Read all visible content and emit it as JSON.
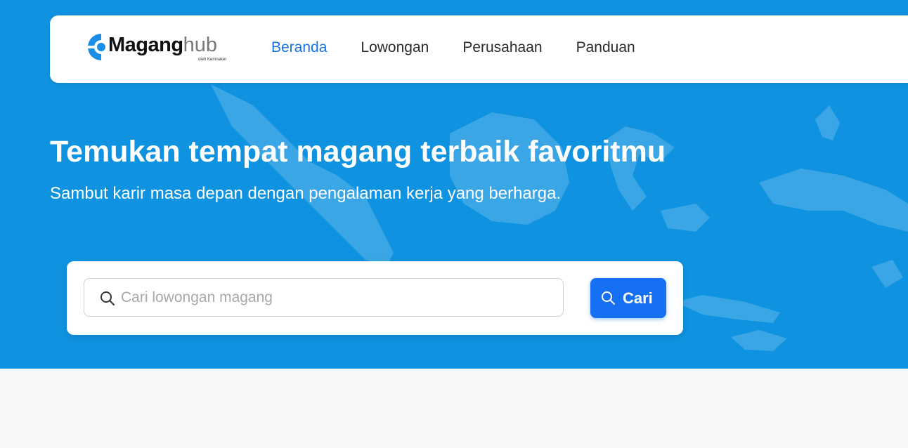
{
  "brand": {
    "name": "Magang",
    "suffix": "hub",
    "tagline": "oleh Kemnaker",
    "colors": {
      "primary": "#0f93e0",
      "accent": "#1673e6",
      "button": "#1570f2"
    }
  },
  "nav": {
    "items": [
      {
        "label": "Beranda",
        "active": true
      },
      {
        "label": "Lowongan",
        "active": false
      },
      {
        "label": "Perusahaan",
        "active": false
      },
      {
        "label": "Panduan",
        "active": false
      }
    ]
  },
  "hero": {
    "title": "Temukan tempat magang terbaik favoritmu",
    "subtitle": "Sambut karir masa depan dengan pengalaman kerja yang berharga."
  },
  "search": {
    "placeholder": "Cari lowongan magang",
    "value": "",
    "button_label": "Cari",
    "icon": "search-icon"
  }
}
